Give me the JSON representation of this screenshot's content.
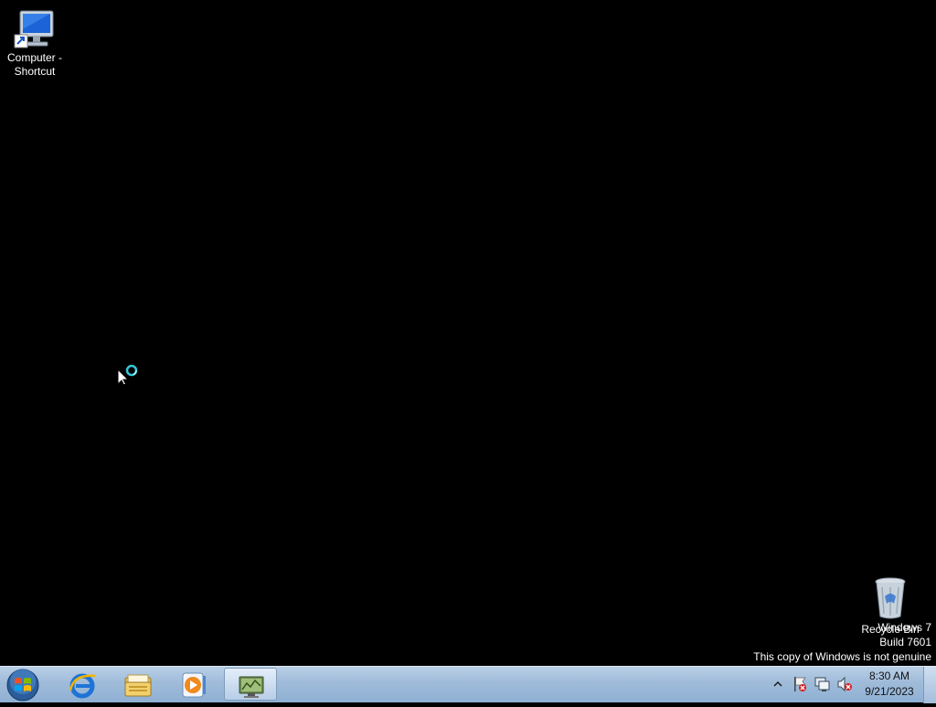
{
  "desktop": {
    "icons": [
      {
        "label": "Computer -\nShortcut"
      },
      {
        "label": "Recycle Bin"
      }
    ],
    "watermark": {
      "line1": "Windows 7",
      "line2": "Build 7601",
      "line3": "This copy of Windows is not genuine"
    }
  },
  "taskbar": {
    "pinned": [
      "internet-explorer-icon",
      "windows-explorer-icon",
      "media-player-icon",
      "network-app-icon"
    ],
    "tray": [
      "show-hidden-icons-chevron",
      "action-center-flag-icon",
      "network-icon",
      "volume-muted-icon"
    ],
    "clock": {
      "time": "8:30 AM",
      "date": "9/21/2023"
    }
  }
}
